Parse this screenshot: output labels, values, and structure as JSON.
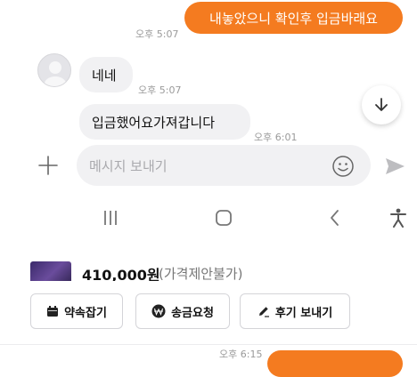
{
  "messages": {
    "outgoing_1": {
      "text": "내놓았으니 확인후 입금바래요",
      "time": "오후 5:07"
    },
    "incoming_1": {
      "text": "네네",
      "time": "오후 5:07"
    },
    "incoming_2": {
      "text": "입금했어요가져갑니다",
      "time": "오후 6:01"
    },
    "outgoing_2": {
      "time": "오후 6:15"
    }
  },
  "composer": {
    "placeholder": "메시지 보내기"
  },
  "product": {
    "price": "410,000원",
    "note": "(가격제안불가)"
  },
  "actions": {
    "appointment": "약속잡기",
    "request_payment": "송금요청",
    "send_review": "후기 보내기"
  },
  "colors": {
    "accent": "#f47b20",
    "bubble_in": "#f1f1f3"
  },
  "icons": [
    "chevron-down-icon",
    "plus-icon",
    "emoji-icon",
    "send-icon",
    "recent-apps-icon",
    "home-icon",
    "back-icon",
    "accessibility-icon",
    "calendar-icon",
    "won-icon",
    "pencil-icon",
    "avatar"
  ]
}
